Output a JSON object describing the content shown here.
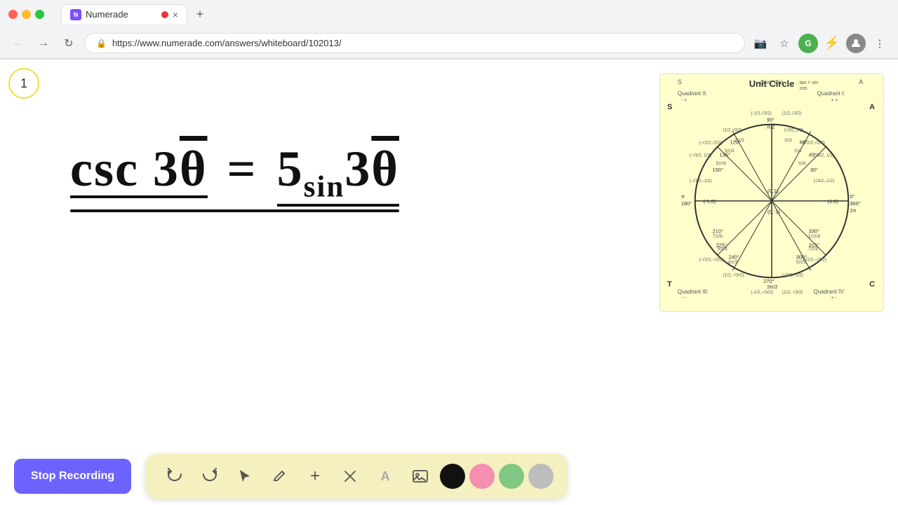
{
  "browser": {
    "tab_label": "Numerade",
    "url": "https://www.numerade.com/answers/whiteboard/102013/",
    "recording_dot": true,
    "new_tab_icon": "+"
  },
  "nav": {
    "back_icon": "←",
    "forward_icon": "→",
    "refresh_icon": "↻",
    "menu_icon": "⋮"
  },
  "page": {
    "number": "1"
  },
  "equation": {
    "text": "csc 3θ = 5sin3θ"
  },
  "unit_circle": {
    "title": "Unit Circle",
    "label_s": "S",
    "label_a": "A",
    "label_t": "T",
    "label_c": "C",
    "quadrant2_label": "Quadrant II:",
    "quadrant4_label": "Quadrant IV:",
    "quadrant3_label": "Quadrant III:",
    "cos_sin_label": "(cos, sin)",
    "tan_label": "tan =  sin",
    "cos_label": "         cos"
  },
  "toolbar": {
    "undo_icon": "↺",
    "redo_icon": "↻",
    "select_icon": "▲",
    "pen_icon": "✏",
    "plus_icon": "+",
    "eraser_icon": "/",
    "text_icon": "A",
    "image_icon": "🖼",
    "stop_recording_label": "Stop Recording"
  }
}
